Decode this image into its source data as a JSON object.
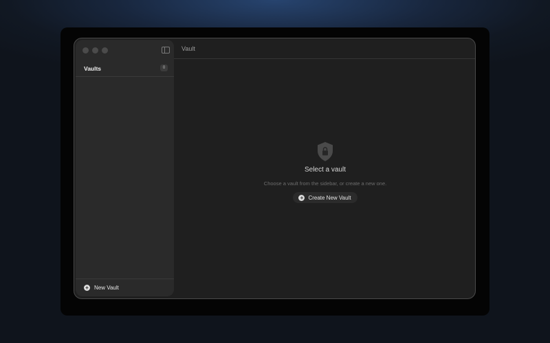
{
  "sidebar": {
    "title": "Vaults",
    "count": "0",
    "footer": {
      "new_vault_label": "New Vault",
      "icon": "plus-circle-icon"
    },
    "toggle_icon": "sidebar-toggle-icon"
  },
  "header": {
    "title": "Vault"
  },
  "empty_state": {
    "icon": "shield-lock-icon",
    "title": "Select a vault",
    "subtitle": "Choose a vault from the sidebar, or create a new one.",
    "button_label": "Create New Vault"
  },
  "colors": {
    "window_bg": "#1f1f1f",
    "sidebar_bg": "#2a2a2a",
    "text_primary": "#e6e6e6",
    "text_muted": "#6d6d6d"
  }
}
